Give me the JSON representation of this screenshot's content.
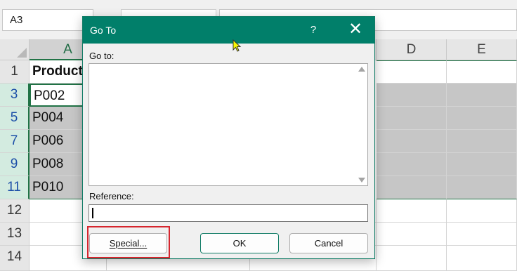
{
  "formula_bar": {
    "name_box": "A3"
  },
  "columns": [
    "A",
    "D",
    "E"
  ],
  "rows": [
    {
      "num": "1",
      "a": "Product",
      "selected": false,
      "bold": true
    },
    {
      "num": "3",
      "a": "P002",
      "selected": true
    },
    {
      "num": "5",
      "a": "P004",
      "selected": true
    },
    {
      "num": "7",
      "a": "P006",
      "selected": true
    },
    {
      "num": "9",
      "a": "P008",
      "selected": true
    },
    {
      "num": "11",
      "a": "P010",
      "selected": true
    },
    {
      "num": "12",
      "a": "",
      "selected": false
    },
    {
      "num": "13",
      "a": "",
      "selected": false
    },
    {
      "num": "14",
      "a": "",
      "selected": false
    }
  ],
  "dialog": {
    "title": "Go To",
    "help": "?",
    "close": "✕",
    "goto_label": "Go to:",
    "goto_items": [],
    "reference_label": "Reference:",
    "reference_value": "",
    "special_button": "Special...",
    "ok_button": "OK",
    "cancel_button": "Cancel"
  },
  "colors": {
    "title_bar": "#017f6a",
    "selection_fill": "#c6c6c6",
    "highlight_box": "#d6262e",
    "header_selected": "#217346"
  }
}
